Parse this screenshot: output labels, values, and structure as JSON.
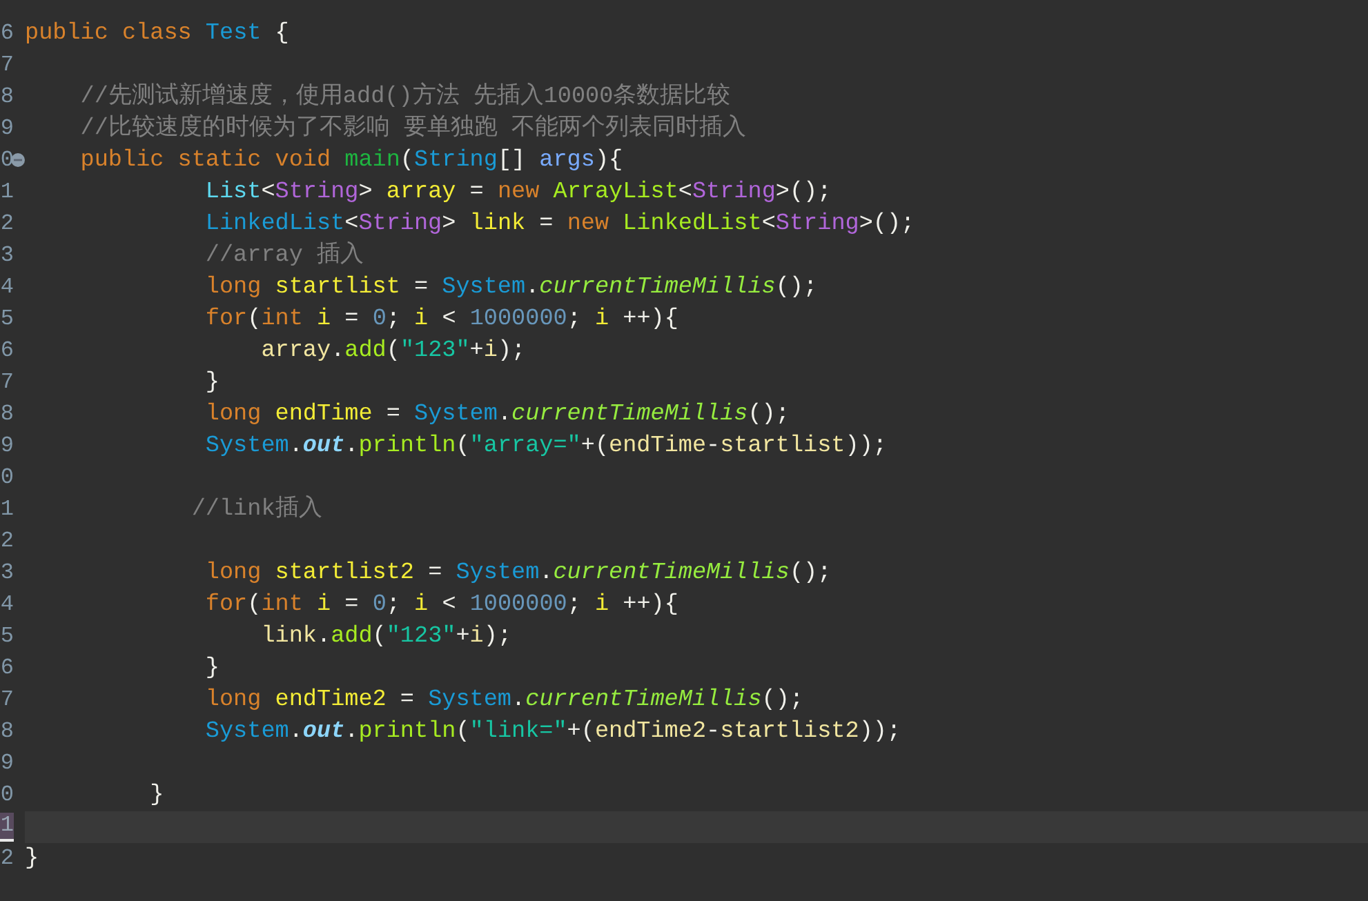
{
  "editor": {
    "lines": [
      {
        "number": "6",
        "current": false,
        "fold": false,
        "tokens": [
          {
            "text": "public class ",
            "kind": "keyword"
          },
          {
            "text": "Test",
            "kind": "class-name"
          },
          {
            "text": " {",
            "kind": "plain"
          }
        ]
      },
      {
        "number": "7",
        "current": false,
        "fold": false
      },
      {
        "number": "8",
        "current": false,
        "fold": false,
        "tokens": [
          {
            "text": "    //先测试新增速度，使用add()方法 先插入10000条数据比较",
            "kind": "comment"
          }
        ]
      },
      {
        "number": "9",
        "current": false,
        "fold": false,
        "tokens": [
          {
            "text": "    //比较速度的时候为了不影响 要单独跑 不能两个列表同时插入",
            "kind": "comment"
          }
        ]
      },
      {
        "number": "0",
        "current": false,
        "fold": true,
        "tokens": [
          {
            "text": "    public static void ",
            "kind": "keyword"
          },
          {
            "text": "main",
            "kind": "method-decl"
          },
          {
            "text": "(",
            "kind": "plain"
          },
          {
            "text": "String",
            "kind": "class-ref"
          },
          {
            "text": "[] ",
            "kind": "plain"
          },
          {
            "text": "args",
            "kind": "param"
          },
          {
            "text": "){",
            "kind": "plain"
          }
        ]
      },
      {
        "number": "1",
        "current": false,
        "fold": false,
        "tokens": [
          {
            "text": "             List",
            "kind": "interface"
          },
          {
            "text": "<",
            "kind": "plain"
          },
          {
            "text": "String",
            "kind": "type-arg"
          },
          {
            "text": "> ",
            "kind": "plain"
          },
          {
            "text": "array",
            "kind": "variable"
          },
          {
            "text": " = ",
            "kind": "plain"
          },
          {
            "text": "new ",
            "kind": "keyword"
          },
          {
            "text": "ArrayList",
            "kind": "class-new"
          },
          {
            "text": "<",
            "kind": "plain"
          },
          {
            "text": "String",
            "kind": "type-arg"
          },
          {
            "text": ">();",
            "kind": "plain"
          }
        ]
      },
      {
        "number": "2",
        "current": false,
        "fold": false,
        "tokens": [
          {
            "text": "             LinkedList",
            "kind": "class-ref"
          },
          {
            "text": "<",
            "kind": "plain"
          },
          {
            "text": "String",
            "kind": "type-arg"
          },
          {
            "text": "> ",
            "kind": "plain"
          },
          {
            "text": "link",
            "kind": "variable"
          },
          {
            "text": " = ",
            "kind": "plain"
          },
          {
            "text": "new ",
            "kind": "keyword"
          },
          {
            "text": "LinkedList",
            "kind": "class-new"
          },
          {
            "text": "<",
            "kind": "plain"
          },
          {
            "text": "String",
            "kind": "type-arg"
          },
          {
            "text": ">();",
            "kind": "plain"
          }
        ]
      },
      {
        "number": "3",
        "current": false,
        "fold": false,
        "tokens": [
          {
            "text": "             //array 插入",
            "kind": "comment"
          }
        ]
      },
      {
        "number": "4",
        "current": false,
        "fold": false,
        "tokens": [
          {
            "text": "             long ",
            "kind": "keyword"
          },
          {
            "text": "startlist",
            "kind": "variable"
          },
          {
            "text": " = ",
            "kind": "plain"
          },
          {
            "text": "System",
            "kind": "class-ref"
          },
          {
            "text": ".",
            "kind": "plain"
          },
          {
            "text": "currentTimeMillis",
            "kind": "static-method"
          },
          {
            "text": "();",
            "kind": "plain"
          }
        ]
      },
      {
        "number": "5",
        "current": false,
        "fold": false,
        "tokens": [
          {
            "text": "             for",
            "kind": "keyword"
          },
          {
            "text": "(",
            "kind": "plain"
          },
          {
            "text": "int ",
            "kind": "keyword"
          },
          {
            "text": "i",
            "kind": "variable"
          },
          {
            "text": " = ",
            "kind": "plain"
          },
          {
            "text": "0",
            "kind": "number"
          },
          {
            "text": "; ",
            "kind": "plain"
          },
          {
            "text": "i",
            "kind": "variable"
          },
          {
            "text": " < ",
            "kind": "plain"
          },
          {
            "text": "1000000",
            "kind": "number"
          },
          {
            "text": "; ",
            "kind": "plain"
          },
          {
            "text": "i",
            "kind": "variable"
          },
          {
            "text": " ++){",
            "kind": "plain"
          }
        ]
      },
      {
        "number": "6",
        "current": false,
        "fold": false,
        "tokens": [
          {
            "text": "                 array",
            "kind": "local"
          },
          {
            "text": ".",
            "kind": "plain"
          },
          {
            "text": "add",
            "kind": "method"
          },
          {
            "text": "(",
            "kind": "plain"
          },
          {
            "text": "\"123\"",
            "kind": "string"
          },
          {
            "text": "+",
            "kind": "plain"
          },
          {
            "text": "i",
            "kind": "local"
          },
          {
            "text": ");",
            "kind": "plain"
          }
        ]
      },
      {
        "number": "7",
        "current": false,
        "fold": false,
        "tokens": [
          {
            "text": "             }",
            "kind": "plain"
          }
        ]
      },
      {
        "number": "8",
        "current": false,
        "fold": false,
        "tokens": [
          {
            "text": "             long ",
            "kind": "keyword"
          },
          {
            "text": "endTime",
            "kind": "variable"
          },
          {
            "text": " = ",
            "kind": "plain"
          },
          {
            "text": "System",
            "kind": "class-ref"
          },
          {
            "text": ".",
            "kind": "plain"
          },
          {
            "text": "currentTimeMillis",
            "kind": "static-method"
          },
          {
            "text": "();",
            "kind": "plain"
          }
        ]
      },
      {
        "number": "9",
        "current": false,
        "fold": false,
        "tokens": [
          {
            "text": "             System",
            "kind": "class-ref"
          },
          {
            "text": ".",
            "kind": "plain"
          },
          {
            "text": "out",
            "kind": "static-field"
          },
          {
            "text": ".",
            "kind": "plain"
          },
          {
            "text": "println",
            "kind": "method"
          },
          {
            "text": "(",
            "kind": "plain"
          },
          {
            "text": "\"array=\"",
            "kind": "string"
          },
          {
            "text": "+(",
            "kind": "plain"
          },
          {
            "text": "endTime",
            "kind": "local"
          },
          {
            "text": "-",
            "kind": "plain"
          },
          {
            "text": "startlist",
            "kind": "local"
          },
          {
            "text": "));",
            "kind": "plain"
          }
        ]
      },
      {
        "number": "0",
        "current": false,
        "fold": false
      },
      {
        "number": "1",
        "current": false,
        "fold": false,
        "tokens": [
          {
            "text": "            //link插入",
            "kind": "comment"
          }
        ]
      },
      {
        "number": "2",
        "current": false,
        "fold": false
      },
      {
        "number": "3",
        "current": false,
        "fold": false,
        "tokens": [
          {
            "text": "             long ",
            "kind": "keyword"
          },
          {
            "text": "startlist2",
            "kind": "variable"
          },
          {
            "text": " = ",
            "kind": "plain"
          },
          {
            "text": "System",
            "kind": "class-ref"
          },
          {
            "text": ".",
            "kind": "plain"
          },
          {
            "text": "currentTimeMillis",
            "kind": "static-method"
          },
          {
            "text": "();",
            "kind": "plain"
          }
        ]
      },
      {
        "number": "4",
        "current": false,
        "fold": false,
        "tokens": [
          {
            "text": "             for",
            "kind": "keyword"
          },
          {
            "text": "(",
            "kind": "plain"
          },
          {
            "text": "int ",
            "kind": "keyword"
          },
          {
            "text": "i",
            "kind": "variable"
          },
          {
            "text": " = ",
            "kind": "plain"
          },
          {
            "text": "0",
            "kind": "number"
          },
          {
            "text": "; ",
            "kind": "plain"
          },
          {
            "text": "i",
            "kind": "variable"
          },
          {
            "text": " < ",
            "kind": "plain"
          },
          {
            "text": "1000000",
            "kind": "number"
          },
          {
            "text": "; ",
            "kind": "plain"
          },
          {
            "text": "i",
            "kind": "variable"
          },
          {
            "text": " ++){",
            "kind": "plain"
          }
        ]
      },
      {
        "number": "5",
        "current": false,
        "fold": false,
        "tokens": [
          {
            "text": "                 link",
            "kind": "local"
          },
          {
            "text": ".",
            "kind": "plain"
          },
          {
            "text": "add",
            "kind": "method"
          },
          {
            "text": "(",
            "kind": "plain"
          },
          {
            "text": "\"123\"",
            "kind": "string"
          },
          {
            "text": "+",
            "kind": "plain"
          },
          {
            "text": "i",
            "kind": "local"
          },
          {
            "text": ");",
            "kind": "plain"
          }
        ]
      },
      {
        "number": "6",
        "current": false,
        "fold": false,
        "tokens": [
          {
            "text": "             }",
            "kind": "plain"
          }
        ]
      },
      {
        "number": "7",
        "current": false,
        "fold": false,
        "tokens": [
          {
            "text": "             long ",
            "kind": "keyword"
          },
          {
            "text": "endTime2",
            "kind": "variable"
          },
          {
            "text": " = ",
            "kind": "plain"
          },
          {
            "text": "System",
            "kind": "class-ref"
          },
          {
            "text": ".",
            "kind": "plain"
          },
          {
            "text": "currentTimeMillis",
            "kind": "static-method"
          },
          {
            "text": "();",
            "kind": "plain"
          }
        ]
      },
      {
        "number": "8",
        "current": false,
        "fold": false,
        "tokens": [
          {
            "text": "             System",
            "kind": "class-ref"
          },
          {
            "text": ".",
            "kind": "plain"
          },
          {
            "text": "out",
            "kind": "static-field"
          },
          {
            "text": ".",
            "kind": "plain"
          },
          {
            "text": "println",
            "kind": "method"
          },
          {
            "text": "(",
            "kind": "plain"
          },
          {
            "text": "\"link=\"",
            "kind": "string"
          },
          {
            "text": "+(",
            "kind": "plain"
          },
          {
            "text": "endTime2",
            "kind": "local"
          },
          {
            "text": "-",
            "kind": "plain"
          },
          {
            "text": "startlist2",
            "kind": "local"
          },
          {
            "text": "));",
            "kind": "plain"
          }
        ]
      },
      {
        "number": "9",
        "current": false,
        "fold": false
      },
      {
        "number": "0",
        "current": false,
        "fold": false,
        "tokens": [
          {
            "text": "         }",
            "kind": "plain"
          }
        ]
      },
      {
        "number": "1",
        "current": true,
        "fold": false
      },
      {
        "number": "2",
        "current": false,
        "fold": false,
        "tokens": [
          {
            "text": "}",
            "kind": "plain"
          }
        ]
      }
    ]
  }
}
